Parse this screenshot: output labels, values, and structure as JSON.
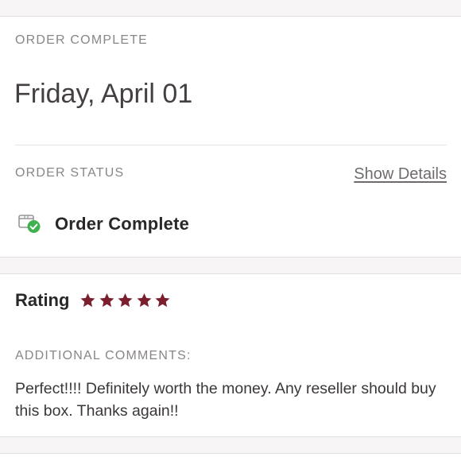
{
  "order": {
    "section_label": "ORDER COMPLETE",
    "date": "Friday, April 01",
    "status_label": "ORDER STATUS",
    "show_details_label": "Show Details",
    "status_text": "Order Complete",
    "status_icon": "package-check-icon"
  },
  "review": {
    "rating_label": "Rating",
    "rating_value": 5,
    "rating_max": 5,
    "star_color": "#7b1f2e",
    "comments_label": "ADDITIONAL COMMENTS:",
    "comment": "Perfect!!!! Definitely worth the money. Any reseller should buy this box. Thanks again!!"
  },
  "colors": {
    "status_check": "#3fb24f"
  }
}
